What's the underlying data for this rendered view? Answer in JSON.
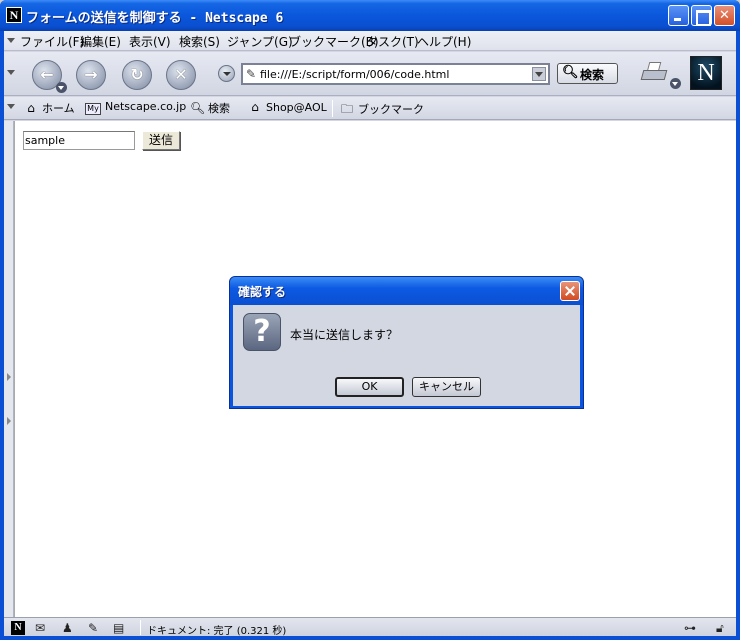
{
  "window": {
    "title": "フォームの送信を制御する - Netscape 6",
    "app_icon": "N"
  },
  "menubar": {
    "items": [
      "ファイル(F)",
      "編集(E)",
      "表示(V)",
      "検索(S)",
      "ジャンプ(G)",
      "ブックマーク(B)",
      "タスク(T)",
      "ヘルプ(H)"
    ]
  },
  "navbar": {
    "url": "file:///E:/script/form/006/code.html",
    "search_label": "検索",
    "logo": "N"
  },
  "personal_toolbar": {
    "items": [
      {
        "icon": "home-icon",
        "label": "ホーム"
      },
      {
        "icon": "my-netscape-icon",
        "label": "Netscape.co.jp",
        "badge": "My"
      },
      {
        "icon": "search-icon",
        "label": "検索"
      },
      {
        "icon": "shop-icon",
        "label": "Shop@AOL"
      },
      {
        "icon": "folder-icon",
        "label": "ブックマーク"
      }
    ]
  },
  "page": {
    "input_value": "sample",
    "submit_label": "送信"
  },
  "dialog": {
    "title": "確認する",
    "message": "本当に送信します？",
    "ok_label": "OK",
    "cancel_label": "キャンセル",
    "icon": "question-icon"
  },
  "statusbar": {
    "text": "ドキュメント: 完了 (0.321 秒)"
  }
}
